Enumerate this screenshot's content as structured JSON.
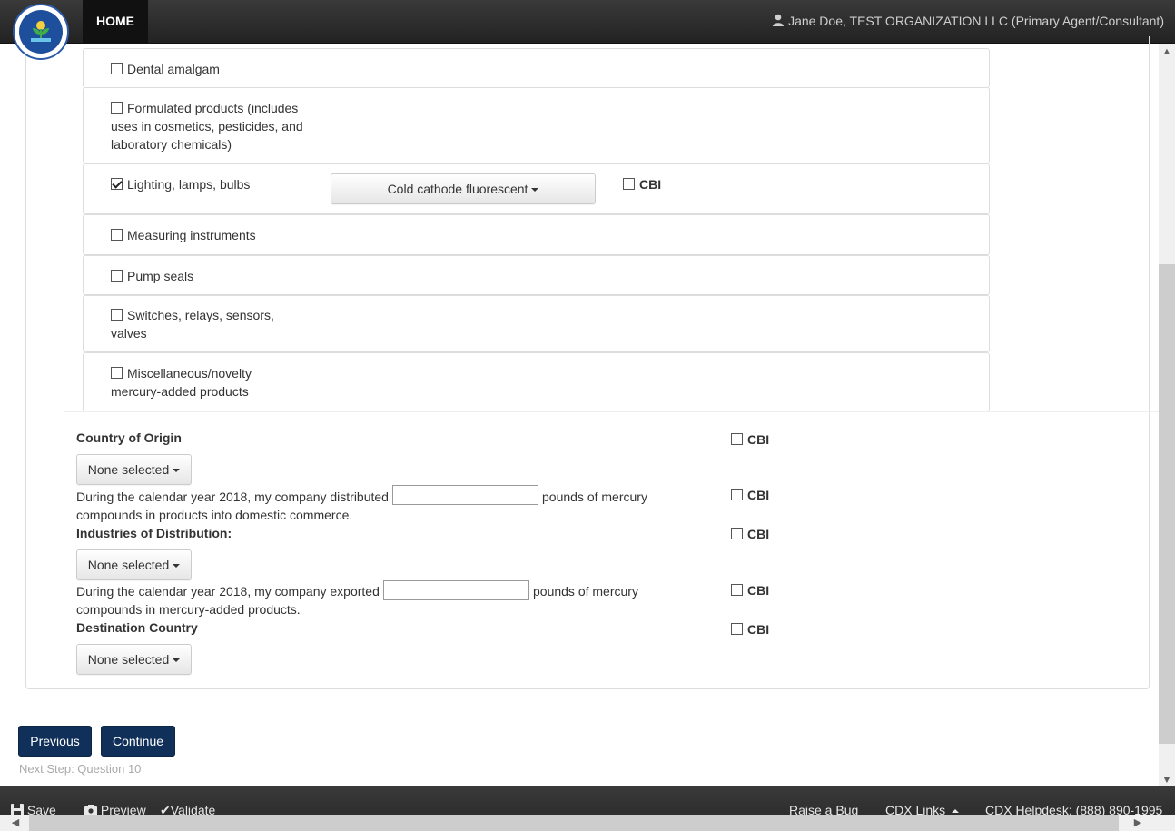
{
  "header": {
    "home_label": "HOME",
    "user_text": "Jane Doe, TEST ORGANIZATION LLC (Primary Agent/Consultant)"
  },
  "product_items": [
    {
      "label": "Dental amalgam",
      "checked": false
    },
    {
      "label_lines": [
        "Formulated products (includes",
        "uses in cosmetics, pesticides, and",
        "laboratory chemicals)"
      ],
      "checked": false
    },
    {
      "label": "Lighting, lamps, bulbs",
      "checked": true,
      "dropdown": "Cold cathode fluorescent",
      "cbi": "CBI"
    },
    {
      "label": "Measuring instruments",
      "checked": false
    },
    {
      "label": "Pump seals",
      "checked": false
    },
    {
      "label_lines": [
        "Switches, relays, sensors,",
        "valves"
      ],
      "checked": false
    },
    {
      "label_lines": [
        "Miscellaneous/novelty",
        "mercury-added products"
      ],
      "checked": false
    }
  ],
  "country_of_origin": {
    "label": "Country of Origin",
    "dropdown": "None selected",
    "cbi": "CBI"
  },
  "distributed": {
    "text_before": "During the calendar year 2018, my company distributed",
    "text_after": "pounds of mercury",
    "text_line2": "compounds in products into domestic commerce.",
    "value": "",
    "cbi": "CBI"
  },
  "industries": {
    "label": "Industries of Distribution:",
    "dropdown": "None selected",
    "cbi": "CBI"
  },
  "exported": {
    "text_before": "During the calendar year 2018, my company exported",
    "text_after": "pounds of mercury",
    "text_line2": "compounds in mercury-added products.",
    "value": "",
    "cbi": "CBI"
  },
  "destination": {
    "label": "Destination Country",
    "dropdown": "None selected",
    "cbi": "CBI"
  },
  "nav": {
    "previous": "Previous",
    "continue": "Continue",
    "next_step": "Next Step: Question 10"
  },
  "footer": {
    "save": "Save",
    "preview": "Preview",
    "validate": "Validate",
    "raise_bug": "Raise a Bug",
    "cdx_links": "CDX Links",
    "helpdesk": "CDX Helpdesk: (888) 890-1995"
  },
  "colors": {
    "primary_button": "#10305a",
    "nav_bar": "#2b2b2b"
  }
}
